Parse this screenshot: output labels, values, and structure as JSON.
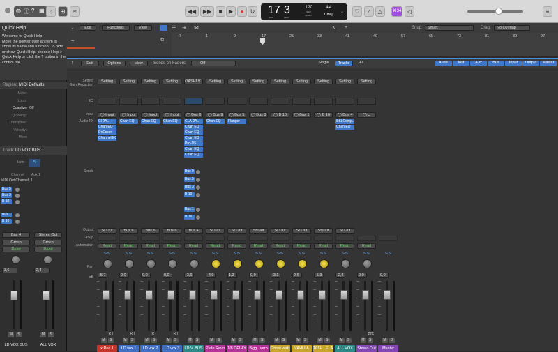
{
  "lcd": {
    "bar": "17",
    "beat": "3",
    "bar_label": "BAR",
    "beat_label": "BEAT",
    "tempo": "120",
    "tempo_label": "KEEP",
    "tempo_sub": "TEMPO",
    "sig": "4/4",
    "key": "Cmaj"
  },
  "toolbar": {
    "badge": "⌘34"
  },
  "quickhelp": {
    "title": "Quick Help",
    "text": "Welcome to Quick Help\nMove the pointer over an item to show its name and function. To hide or show Quick Help, choose Help > Quick Help or click the ? button in the control bar."
  },
  "region": {
    "label": "Region:",
    "value": "MIDI Defaults",
    "rows": [
      "Mute:",
      "Loop:",
      "Quantize",
      "Q-Swing:",
      "Transpose:",
      "Velocity:",
      "More"
    ],
    "quantize": "Off"
  },
  "track": {
    "label": "Track:",
    "value": "LD VOX BUS",
    "icon_label": "Icon:",
    "channel_label": "Channel",
    "channel_value": "Aux 1",
    "midi_label": "MIDI Out Channel:",
    "midi_value": "1"
  },
  "trackhdr": {
    "edit": "Edit",
    "functions": "Functions",
    "view": "View",
    "snap_label": "Snap:",
    "snap": "Smart",
    "drag_label": "Drag:",
    "drag": "No Overlap",
    "ruler": [
      "-7",
      "1",
      "9",
      "17",
      "25",
      "33",
      "41",
      "49",
      "57",
      "65",
      "73",
      "81",
      "89",
      "97"
    ]
  },
  "mixbar": {
    "edit": "Edit",
    "options": "Options",
    "view": "View",
    "sends_label": "Sends on Faders:",
    "sends_value": "Off",
    "single": "Single",
    "tracks": "Tracks",
    "all": "All",
    "filters": [
      "Audio",
      "Inst",
      "Aux",
      "Bus",
      "Input",
      "Output",
      "Master"
    ]
  },
  "rowlabels": {
    "setting": "Setting",
    "gain": "Gain Reduction",
    "eq": "EQ",
    "input": "Input",
    "fx": "Audio FX",
    "sends": "Sends",
    "output": "Output",
    "group": "Group",
    "automation": "Automation",
    "pan": "Pan",
    "db": "dB"
  },
  "colors": {
    "red": "#c6342a",
    "blue": "#3f6fc4",
    "teal": "#2b8a87",
    "pink": "#b6339a",
    "yellow": "#c9a62a",
    "purple": "#8546b5",
    "green": "#4aa84d"
  },
  "left_strips": [
    {
      "sends": [
        "Bus 5",
        "Bus 3",
        "B 10",
        "Bus 1",
        "B 16"
      ],
      "output": "Bus 4",
      "group": "Group",
      "auto": "Read",
      "db": "-3,6",
      "name": "LD VOX BUS"
    },
    {
      "sends": [],
      "output": "Stereo Out",
      "group": "Group",
      "auto": "Read",
      "db": "-2,4",
      "name": "ALL VOX"
    }
  ],
  "strips": [
    {
      "setting": "Setting",
      "input": "Input",
      "fx": [
        "Cl-2A..",
        "Chan EQ",
        "DeEsser",
        "Channel EQ"
      ],
      "sends": [],
      "output": "St Out",
      "auto": "Read",
      "db": "-5,7",
      "name": "x Rec 1",
      "color": "#c6342a",
      "ri": "R I",
      "pan": "knob"
    },
    {
      "setting": "Setting",
      "input": "Input",
      "fx": [
        "Chan EQ"
      ],
      "sends": [],
      "output": "Bus 6",
      "auto": "Read",
      "db": "0,0",
      "name": "LD vox 1",
      "color": "#3f6fc4",
      "ri": "R I",
      "pan": "knob"
    },
    {
      "setting": "Setting",
      "input": "Input",
      "fx": [
        "Chan EQ"
      ],
      "sends": [],
      "output": "Bus 6",
      "auto": "Read",
      "db": "0,0",
      "name": "LD vox 2",
      "color": "#3f6fc4",
      "ri": "R I",
      "pan": "knob"
    },
    {
      "setting": "Setting",
      "input": "Input",
      "fx": [
        "Chan EQ"
      ],
      "sends": [],
      "output": "Bus 6",
      "auto": "Read",
      "db": "0,0",
      "name": "LD vox 3",
      "color": "#3f6fc4",
      "ri": "R I",
      "pan": "knob"
    },
    {
      "setting": "OASHI V..",
      "input": "Bus 6",
      "fx": [
        "CLA-2A..",
        "Chan EQ",
        "Chan EQ",
        "Chan EQ",
        "Pro-DS",
        "Chan EQ",
        "Chan EQ"
      ],
      "sends": [
        "Bus 9",
        "Bus 5",
        "Bus 3",
        "B 10",
        "Bus 1",
        "B 16"
      ],
      "output": "Bus 4",
      "auto": "Read",
      "db": "-3,6",
      "name": "LD V..BUS",
      "color": "#2b8a87",
      "ri": "",
      "pan": "knob"
    },
    {
      "setting": "Setting",
      "input": "Bus 9",
      "fx": [
        "Chan EQ"
      ],
      "sends": [],
      "output": "St Out",
      "auto": "Read",
      "db": "-4,9",
      "name": "Plate Rev​b",
      "color": "#b6339a",
      "ri": "",
      "pan": "yellow"
    },
    {
      "setting": "Setting",
      "input": "Bus 5",
      "fx": [
        "Flanger"
      ],
      "sends": [],
      "output": "St Out",
      "auto": "Read",
      "db": "1,3",
      "name": "1/8 DELAY",
      "color": "#b6339a",
      "ri": "",
      "pan": "yellow"
    },
    {
      "setting": "Setting",
      "input": "Bus 3",
      "fx": [],
      "sends": [],
      "output": "St Out",
      "auto": "Read",
      "db": "0,9",
      "name": "Bigg...verb",
      "color": "#b6339a",
      "ri": "",
      "pan": "yellow"
    },
    {
      "setting": "Setting",
      "input": "B 10",
      "fx": [],
      "sends": [],
      "output": "St Out",
      "auto": "Read",
      "db": "-3,1",
      "name": "Ghost verb",
      "color": "#c9a62a",
      "ri": "",
      "pan": "yellow"
    },
    {
      "setting": "Setting",
      "input": "Bus 1",
      "fx": [],
      "sends": [],
      "output": "St Out",
      "auto": "Read",
      "db": "2,6",
      "name": "VAHLLA",
      "color": "#c9a62a",
      "ri": "",
      "pan": "yellow"
    },
    {
      "setting": "Setting",
      "input": "B 16",
      "fx": [],
      "sends": [],
      "output": "St Out",
      "auto": "Read",
      "db": "-5,3",
      "name": "16TH...ELAY",
      "color": "#c9a62a",
      "ri": "",
      "pan": "yellow"
    },
    {
      "setting": "Setting",
      "input": "Bus 4",
      "fx": [
        "SSLComp..",
        "Chan EQ"
      ],
      "sends": [],
      "output": "St Out",
      "auto": "Read",
      "db": "-2,4",
      "name": "ALL VOX",
      "color": "#2b8a87",
      "ri": "",
      "pan": "knob"
    },
    {
      "setting": "Setting",
      "input": "",
      "fx": [],
      "sends": [],
      "output": "",
      "auto": "Read",
      "db": "0,0",
      "name": "Stereo Out",
      "color": "#8546b5",
      "ri": "Bnc",
      "pan": "knob"
    },
    {
      "setting": "",
      "input": "",
      "fx": [],
      "sends": [],
      "output": "",
      "auto": "",
      "db": "0,0",
      "name": "Master",
      "color": "#8546b5",
      "ri": "",
      "pan": "none"
    }
  ]
}
